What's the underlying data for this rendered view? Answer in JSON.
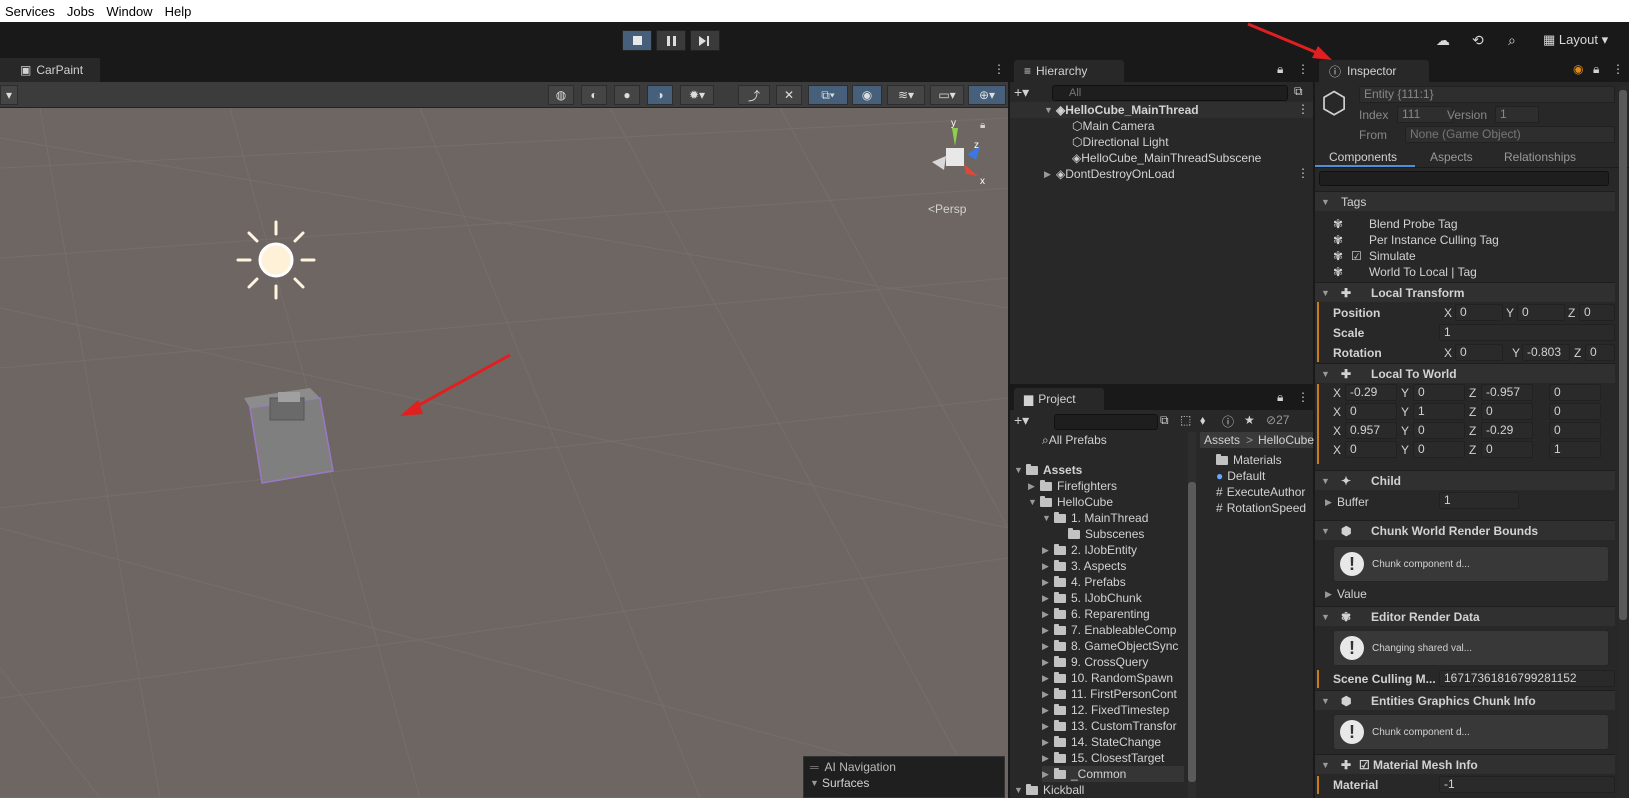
{
  "menu": [
    "Services",
    "Jobs",
    "Window",
    "Help"
  ],
  "toolbar": {
    "layout_label": "Layout"
  },
  "scene": {
    "tab_label": "CarPaint",
    "persp_label": "Persp",
    "gizmo": {
      "x": "x",
      "y": "y",
      "z": "z"
    }
  },
  "hierarchy": {
    "tab_label": "Hierarchy",
    "search_placeholder": "All",
    "items": [
      {
        "label": "HelloCube_MainThread",
        "bold": true
      },
      {
        "label": "Main Camera"
      },
      {
        "label": "Directional Light"
      },
      {
        "label": "HelloCube_MainThreadSubscene"
      },
      {
        "label": "DontDestroyOnLoad"
      }
    ]
  },
  "project": {
    "tab_label": "Project",
    "count": "27",
    "all_prefabs": "All Prefabs",
    "assets": "Assets",
    "tree": [
      "Firefighters",
      "HelloCube",
      "1. MainThread",
      "Subscenes",
      "2. IJobEntity",
      "3. Aspects",
      "4. Prefabs",
      "5. IJobChunk",
      "6. Reparenting",
      "7. EnableableComp",
      "8. GameObjectSync",
      "9. CrossQuery",
      "10. RandomSpawn",
      "11. FirstPersonCont",
      "12. FixedTimestep",
      "13. CustomTransfor",
      "14. StateChange",
      "15. ClosestTarget",
      "_Common",
      "Kickball"
    ],
    "breadcrumb": [
      "Assets",
      "HelloCube"
    ],
    "files": [
      "Materials",
      "Default",
      "ExecuteAuthor",
      "RotationSpeed"
    ]
  },
  "ai_nav": {
    "title": "AI Navigation",
    "surfaces": "Surfaces"
  },
  "inspector": {
    "tab_label": "Inspector",
    "entity": "Entity {111:1}",
    "index_label": "Index",
    "index": "111",
    "version_label": "Version",
    "version": "1",
    "from_label": "From",
    "from": "None (Game Object)",
    "tabs": [
      "Components",
      "Aspects",
      "Relationships"
    ],
    "tags_header": "Tags",
    "tags": [
      "Blend Probe Tag",
      "Per Instance Culling Tag",
      "Simulate",
      "World To Local | Tag"
    ],
    "local_transform": "Local Transform",
    "position_label": "Position",
    "position": [
      "0",
      "0",
      "0"
    ],
    "scale_label": "Scale",
    "scale": "1",
    "rotation_label": "Rotation",
    "rotation": [
      "0",
      "-0.803",
      "0"
    ],
    "local_to_world": "Local To World",
    "ltw_rows": [
      [
        "-0.29",
        "0",
        "-0.957",
        "0"
      ],
      [
        "0",
        "1",
        "0",
        "0"
      ],
      [
        "0.957",
        "0",
        "-0.29",
        "0"
      ],
      [
        "0",
        "0",
        "0",
        "1"
      ]
    ],
    "child": "Child",
    "buffer_label": "Buffer",
    "buffer": "1",
    "chunk_bounds": "Chunk World Render Bounds",
    "help1": "Chunk component d...",
    "value_label": "Value",
    "editor_render": "Editor Render Data",
    "help2": "Changing shared val...",
    "scene_culling_label": "Scene Culling M...",
    "scene_culling": "16717361816799281152",
    "graphics_chunk": "Entities Graphics Chunk Info",
    "help3": "Chunk component d...",
    "material_mesh": "Material Mesh Info",
    "material_label": "Material",
    "material": "-1"
  },
  "colors": {
    "accent": "#46607c",
    "scene_bg": "#6e6662",
    "arrow": "#e02020",
    "modified": "#c77c1a"
  }
}
